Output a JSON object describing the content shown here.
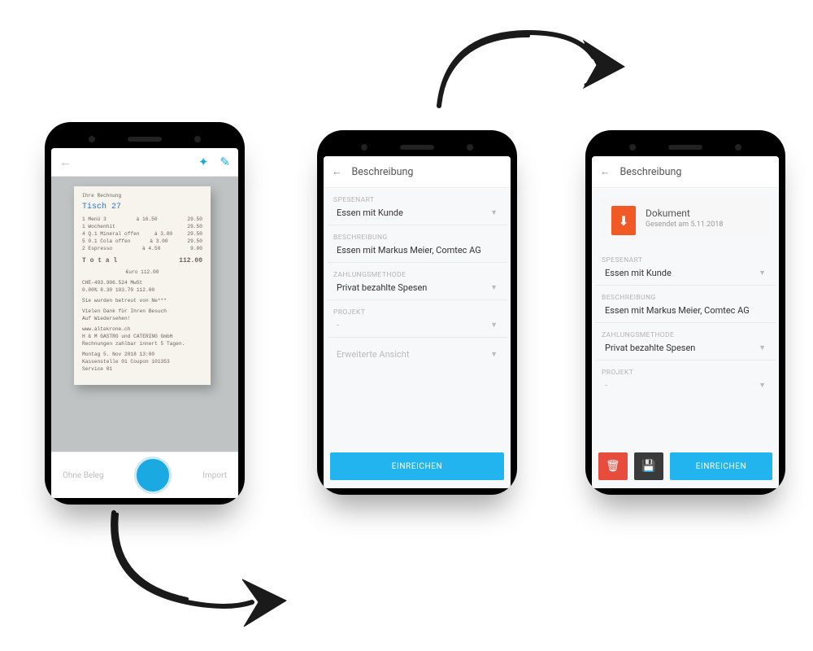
{
  "phone1": {
    "toolbar": {
      "back_glyph": "←",
      "flash_glyph": "✦",
      "wand_glyph": "✎"
    },
    "receipt": {
      "title": "Ihre Rechnung",
      "table": "Tisch 27",
      "lines": [
        {
          "l": "1 Menü 3",
          "m": "à 16.50",
          "r": "29.50"
        },
        {
          "l": "1 Wochenhit",
          "m": "",
          "r": "29.50"
        },
        {
          "l": "4 Q.1 Mineral offen",
          "m": "à 3.00",
          "r": "29.50"
        },
        {
          "l": "5 0.1 Cola offen",
          "m": "à 3.00",
          "r": "29.50"
        },
        {
          "l": "2 Espresso",
          "m": "à 4.50",
          "r": "9.00"
        }
      ],
      "total_label": "T o t a l",
      "total_value": "112.00",
      "euro_line": "€uro 112.00",
      "vat1": "CHE-493.906.524 MwSt",
      "vat2": "0.00%   8.30   103.70   112.00",
      "served": "Sie wurden betreut von Ne***",
      "thanks1": "Vielen Dank für Ihren Besuch",
      "thanks2": "Auf Wiedersehen!",
      "foot1": "www.altekrone.ch",
      "foot2": "H & M GASTRO und CATERING GmbH",
      "foot3": "Rechnungen zahlbar innert 5 Tagen.",
      "date": "Montag 5. Nov 2018 13:00",
      "kasse": "Kassenstelle 01 Coupon 101353",
      "service": "Service 01"
    },
    "cambar": {
      "left": "Ohne Beleg",
      "right": "Import"
    }
  },
  "phone2": {
    "header": "Beschreibung",
    "back_glyph": "←",
    "fields": {
      "spesenart": {
        "label": "SPESENART",
        "value": "Essen mit Kunde"
      },
      "beschreibung": {
        "label": "BESCHREIBUNG",
        "value": "Essen mit Markus Meier, Comtec AG"
      },
      "zahlung": {
        "label": "ZAHLUNGSMETHODE",
        "value": "Privat bezahlte Spesen"
      },
      "projekt": {
        "label": "PROJEKT",
        "value": "-"
      },
      "erweitert": {
        "value": "Erweiterte Ansicht"
      }
    },
    "submit": "EINREICHEN"
  },
  "phone3": {
    "header": "Beschreibung",
    "back_glyph": "←",
    "doc": {
      "title": "Dokument",
      "sub": "Gesendet am  5.11.2018",
      "glyph": "⬇"
    },
    "fields": {
      "spesenart": {
        "label": "SPESENART",
        "value": "Essen mit Kunde"
      },
      "beschreibung": {
        "label": "BESCHREIBUNG",
        "value": "Essen mit Markus Meier, Comtec AG"
      },
      "zahlung": {
        "label": "ZAHLUNGSMETHODE",
        "value": "Privat bezahlte Spesen"
      },
      "projekt": {
        "label": "PROJEKT",
        "value": "-"
      }
    },
    "buttons": {
      "delete_glyph": "🗑",
      "save_glyph": "💾",
      "submit": "EINREICHEN"
    }
  }
}
